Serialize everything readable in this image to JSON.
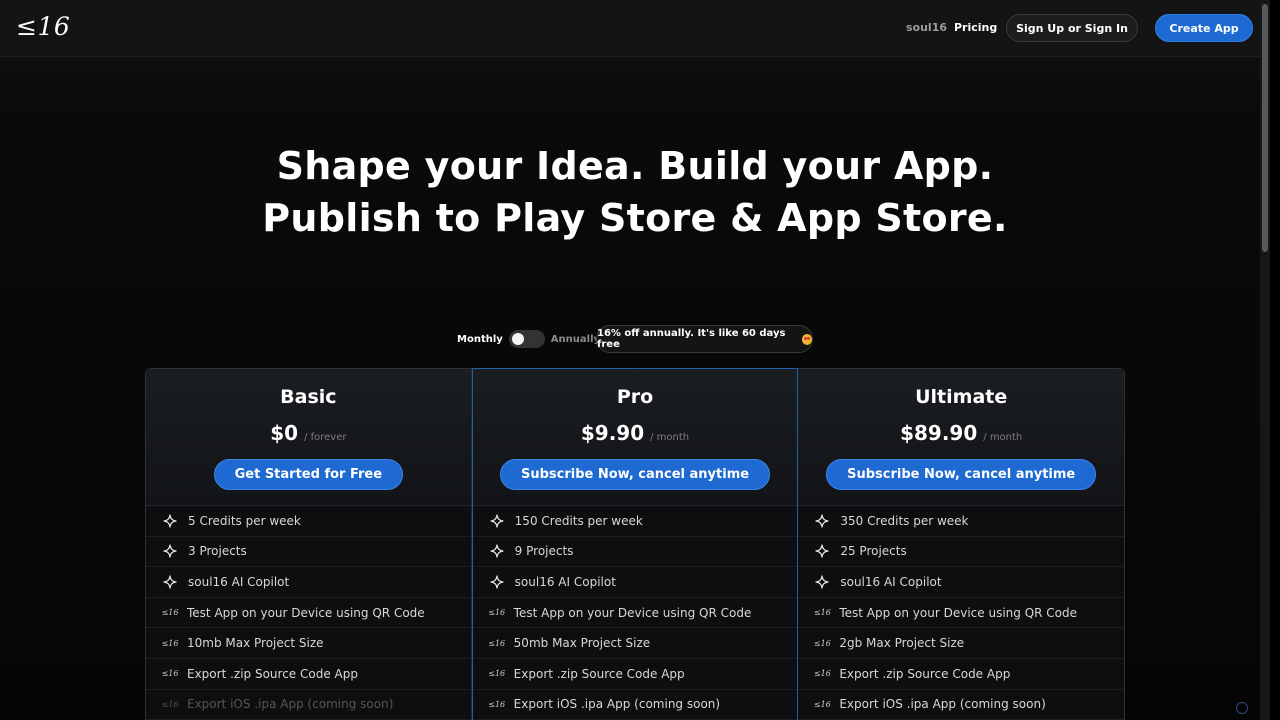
{
  "header": {
    "logo": "≤16",
    "nav_brand": "soul16",
    "nav_pricing": "Pricing",
    "signin_label": "Sign Up or Sign In",
    "create_label": "Create App"
  },
  "hero": {
    "line1": "Shape your Idea. Build your App.",
    "line2": "Publish to Play Store & App Store."
  },
  "billing": {
    "monthly_label": "Monthly",
    "annually_label": "Annually",
    "promo_text": "16% off annually. It's like 60 days free",
    "annual_selected": false
  },
  "colors": {
    "accent": "#1e6ad2",
    "featured_border": "#1f5fae"
  },
  "plans": [
    {
      "name": "Basic",
      "price": "$0",
      "period": "/ forever",
      "button": "Get Started for Free",
      "features": [
        {
          "icon": "sparkle-icon",
          "text": "5 Credits per week",
          "dim": false
        },
        {
          "icon": "sparkle-icon",
          "text": "3 Projects",
          "dim": false
        },
        {
          "icon": "sparkle-icon",
          "text": "soul16 AI Copilot",
          "dim": false
        },
        {
          "icon": "s16-logo-icon",
          "text": "Test App on your Device using QR Code",
          "dim": false
        },
        {
          "icon": "s16-logo-icon",
          "text": "10mb Max Project Size",
          "dim": false
        },
        {
          "icon": "s16-logo-icon",
          "text": "Export .zip Source Code App",
          "dim": false
        },
        {
          "icon": "s16-logo-icon",
          "text": "Export iOS .ipa App (coming soon)",
          "dim": true
        }
      ]
    },
    {
      "name": "Pro",
      "price": "$9.90",
      "period": "/ month",
      "button": "Subscribe Now, cancel anytime",
      "features": [
        {
          "icon": "sparkle-icon",
          "text": "150 Credits per week",
          "dim": false
        },
        {
          "icon": "sparkle-icon",
          "text": "9 Projects",
          "dim": false
        },
        {
          "icon": "sparkle-icon",
          "text": "soul16 AI Copilot",
          "dim": false
        },
        {
          "icon": "s16-logo-icon",
          "text": "Test App on your Device using QR Code",
          "dim": false
        },
        {
          "icon": "s16-logo-icon",
          "text": "50mb Max Project Size",
          "dim": false
        },
        {
          "icon": "s16-logo-icon",
          "text": "Export .zip Source Code App",
          "dim": false
        },
        {
          "icon": "s16-logo-icon",
          "text": "Export iOS .ipa App (coming soon)",
          "dim": false
        }
      ]
    },
    {
      "name": "Ultimate",
      "price": "$89.90",
      "period": "/ month",
      "button": "Subscribe Now, cancel anytime",
      "features": [
        {
          "icon": "sparkle-icon",
          "text": "350 Credits per week",
          "dim": false
        },
        {
          "icon": "sparkle-icon",
          "text": "25 Projects",
          "dim": false
        },
        {
          "icon": "sparkle-icon",
          "text": "soul16 AI Copilot",
          "dim": false
        },
        {
          "icon": "s16-logo-icon",
          "text": "Test App on your Device using QR Code",
          "dim": false
        },
        {
          "icon": "s16-logo-icon",
          "text": "2gb Max Project Size",
          "dim": false
        },
        {
          "icon": "s16-logo-icon",
          "text": "Export .zip Source Code App",
          "dim": false
        },
        {
          "icon": "s16-logo-icon",
          "text": "Export iOS .ipa App (coming soon)",
          "dim": false
        }
      ]
    }
  ]
}
